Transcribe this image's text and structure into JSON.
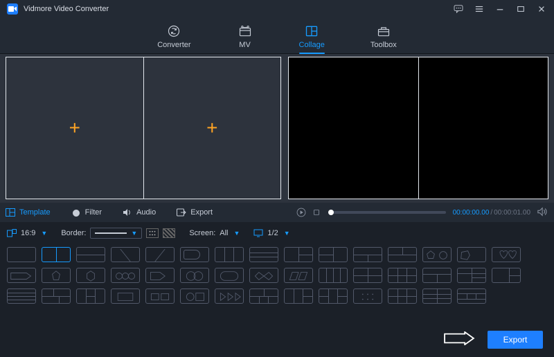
{
  "app": {
    "title": "Vidmore Video Converter"
  },
  "nav": {
    "converter": "Converter",
    "mv": "MV",
    "collage": "Collage",
    "toolbox": "Toolbox",
    "active": "Collage"
  },
  "editor": {
    "slots": 2
  },
  "sectabs": {
    "template": "Template",
    "filter": "Filter",
    "audio": "Audio",
    "export": "Export",
    "active": "Template"
  },
  "playback": {
    "current": "00:00:00.00",
    "duration": "00:00:01.00"
  },
  "controls": {
    "ratio": "16:9",
    "border_label": "Border:",
    "screen_label": "Screen:",
    "screen_value": "All",
    "page": "1/2"
  },
  "footer": {
    "export": "Export"
  }
}
